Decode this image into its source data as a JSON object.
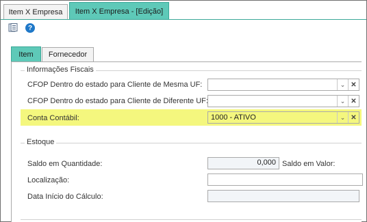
{
  "tabs": {
    "item_x_empresa": "Item X Empresa",
    "item_x_empresa_edicao": "Item X Empresa - [Edição]"
  },
  "toolbar": {
    "help": "?"
  },
  "subtabs": {
    "item": "Item",
    "fornecedor": "Fornecedor"
  },
  "fiscal": {
    "title": "Informações Fiscais",
    "cfop_mesma_label": "CFOP Dentro do estado para Cliente de Mesma UF:",
    "cfop_mesma_value": "",
    "cfop_diferente_label": "CFOP Dentro do estado para Cliente de Diferente UF:",
    "cfop_diferente_value": "",
    "conta_label": "Conta Contábil:",
    "conta_value": "1000 - ATIVO"
  },
  "estoque": {
    "title": "Estoque",
    "saldo_qtd_label": "Saldo em Quantidade:",
    "saldo_qtd_value": "0,000",
    "saldo_valor_label": "Saldo em Valor:",
    "localizacao_label": "Localização:",
    "data_inicio_label": "Data Início do Cálculo:"
  },
  "glyphs": {
    "dropdown": "⌄",
    "clear": "✕"
  },
  "colors": {
    "active_tab": "#5ec9b8",
    "highlight": "#f4f77e"
  }
}
